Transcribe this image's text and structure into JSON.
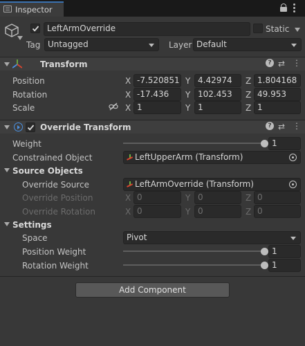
{
  "tab": {
    "title": "Inspector",
    "lock_icon": "lock-icon",
    "menu_icon": "kebab-menu-icon"
  },
  "gameobject": {
    "active": true,
    "name": "LeftArmOverride",
    "static_label": "Static",
    "static": false,
    "tag_label": "Tag",
    "tag_value": "Untagged",
    "layer_label": "Layer",
    "layer_value": "Default"
  },
  "transform": {
    "title": "Transform",
    "position": {
      "label": "Position",
      "x": "-7.520851",
      "y": "4.42974",
      "z": "1.804168"
    },
    "rotation": {
      "label": "Rotation",
      "x": "-17.436",
      "y": "102.453",
      "z": "49.953"
    },
    "scale": {
      "label": "Scale",
      "x": "1",
      "y": "1",
      "z": "1"
    }
  },
  "override": {
    "title": "Override Transform",
    "enabled": true,
    "weight_label": "Weight",
    "weight_value": "1",
    "weight_level": 1,
    "constrained_label": "Constrained Object",
    "constrained_value": "LeftUpperArm (Transform)",
    "source_header": "Source Objects",
    "override_source_label": "Override Source",
    "override_source_value": "LeftArmOverride (Transform)",
    "override_position": {
      "label": "Override Position",
      "x": "0",
      "y": "0",
      "z": "0"
    },
    "override_rotation": {
      "label": "Override Rotation",
      "x": "0",
      "y": "0",
      "z": "0"
    },
    "settings_header": "Settings",
    "space_label": "Space",
    "space_value": "Pivot",
    "pos_weight_label": "Position Weight",
    "pos_weight_value": "1",
    "pos_weight_level": 1,
    "rot_weight_label": "Rotation Weight",
    "rot_weight_value": "1",
    "rot_weight_level": 1
  },
  "axes": {
    "x": "X",
    "y": "Y",
    "z": "Z"
  },
  "add_component": "Add Component",
  "colors": {
    "background": "#383838",
    "field": "#2a2a2a",
    "accent": "#3a72b0",
    "header": "#3e3e3e"
  }
}
